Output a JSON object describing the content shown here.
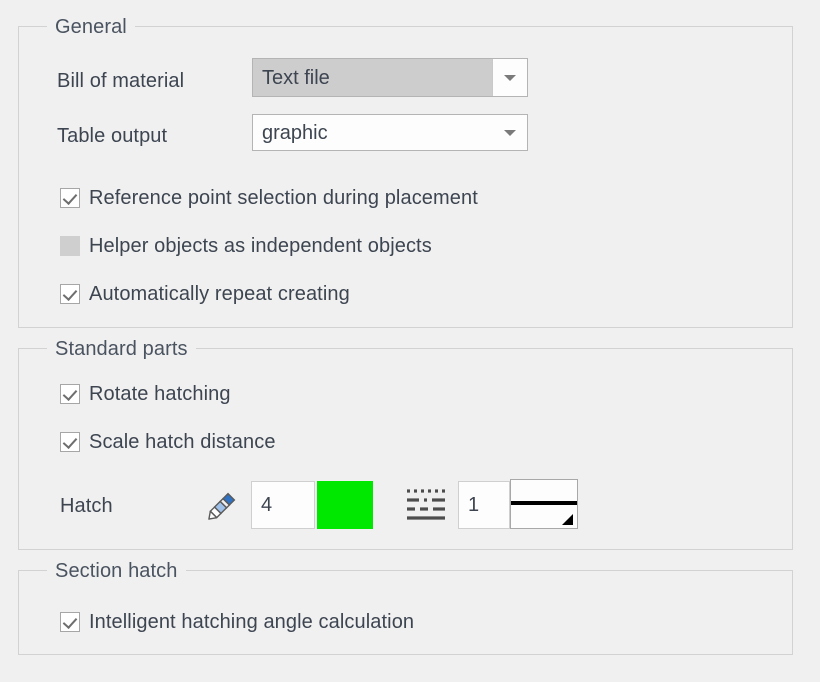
{
  "groups": {
    "general": {
      "legend": "General",
      "fields": [
        {
          "label": "Bill of material",
          "value": "Text file",
          "state": "selected"
        },
        {
          "label": "Table output",
          "value": "graphic",
          "state": "normal"
        }
      ],
      "checkboxes": [
        {
          "label": "Reference point selection during placement",
          "checked": true,
          "enabled": true
        },
        {
          "label": "Helper objects as independent objects",
          "checked": false,
          "enabled": false
        },
        {
          "label": "Automatically repeat creating",
          "checked": true,
          "enabled": true
        }
      ]
    },
    "standard_parts": {
      "legend": "Standard parts",
      "checkboxes": [
        {
          "label": "Rotate hatching",
          "checked": true,
          "enabled": true
        },
        {
          "label": "Scale hatch distance",
          "checked": true,
          "enabled": true
        }
      ],
      "hatch": {
        "label": "Hatch",
        "pen_icon": "pencil-icon",
        "pen_value": "4",
        "color": "#00e800",
        "linestyle_icon": "line-style-icon",
        "linestyle_value": "1",
        "lineweight_preview": "line-weight-preview"
      }
    },
    "section_hatch": {
      "legend": "Section hatch",
      "checkboxes": [
        {
          "label": "Intelligent hatching angle calculation",
          "checked": true,
          "enabled": true
        }
      ]
    }
  }
}
